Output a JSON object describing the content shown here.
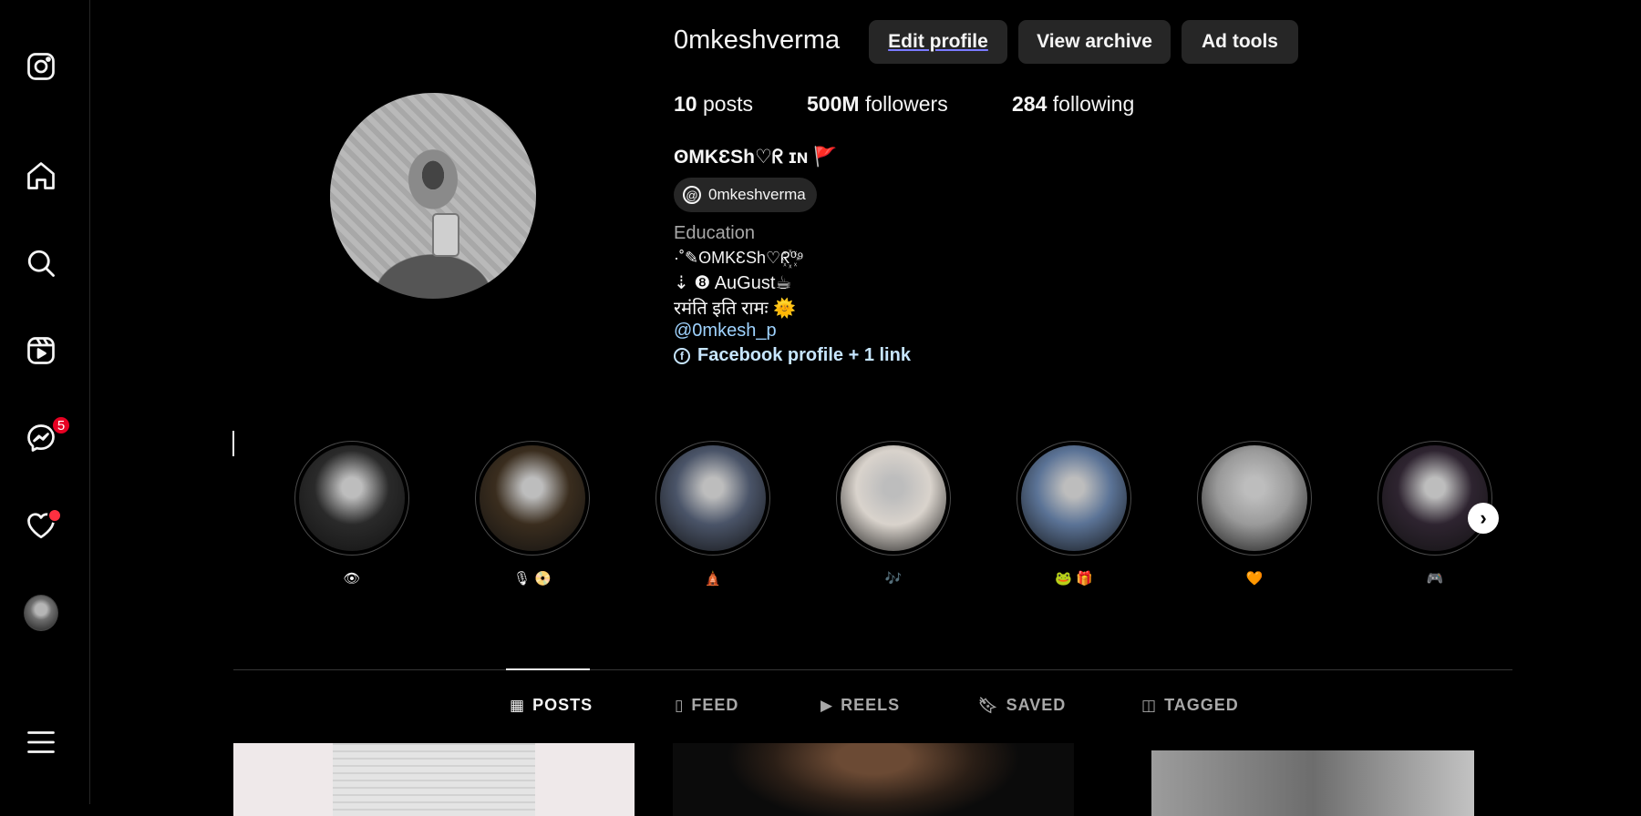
{
  "sidebar": {
    "messages_badge": "5",
    "icons": [
      "instagram-icon",
      "home-icon",
      "search-icon",
      "reels-icon",
      "messenger-icon",
      "heart-icon",
      "profile-avatar",
      "menu-icon"
    ]
  },
  "header": {
    "username": "0mkeshverma",
    "buttons": {
      "edit_profile": "Edit profile",
      "view_archive": "View archive",
      "ad_tools": "Ad tools"
    },
    "stats": {
      "posts_count": "10",
      "posts_label": "posts",
      "followers_count": "500M",
      "followers_label": "followers",
      "following_count": "284",
      "following_label": "following"
    },
    "full_name": "ʘMKƐSh♡ᖇ ɪɴ 🚩",
    "threads_handle": "0mkeshverma",
    "bio": {
      "category": "Education",
      "line1": "·˚✎ʘMKƐSh♡ᖇ꙰⁰⁹",
      "line2": "⇣ ❽ AuGust☕",
      "line3": "रमंति इति रामः 🌞",
      "mention": "@0mkesh_p",
      "links": "Facebook profile + 1 link"
    }
  },
  "highlights": [
    {
      "label": "👁",
      "color": "#2a2a2a"
    },
    {
      "label": "🎙 📀",
      "color": "#3a2d1e"
    },
    {
      "label": "🛕",
      "color": "#4a5468"
    },
    {
      "label": "🎶",
      "color": "#d9d3cc"
    },
    {
      "label": "🐸 🎁",
      "color": "#5b7396"
    },
    {
      "label": "🧡",
      "color": "#9a9a9a"
    },
    {
      "label": "🎮",
      "color": "#2e2430"
    }
  ],
  "tabs": [
    {
      "label": "POSTS",
      "icon": "grid-icon"
    },
    {
      "label": "FEED",
      "icon": "feed-icon"
    },
    {
      "label": "REELS",
      "icon": "reels-tab-icon"
    },
    {
      "label": "SAVED",
      "icon": "bookmark-icon"
    },
    {
      "label": "TAGGED",
      "icon": "tagged-icon"
    }
  ]
}
